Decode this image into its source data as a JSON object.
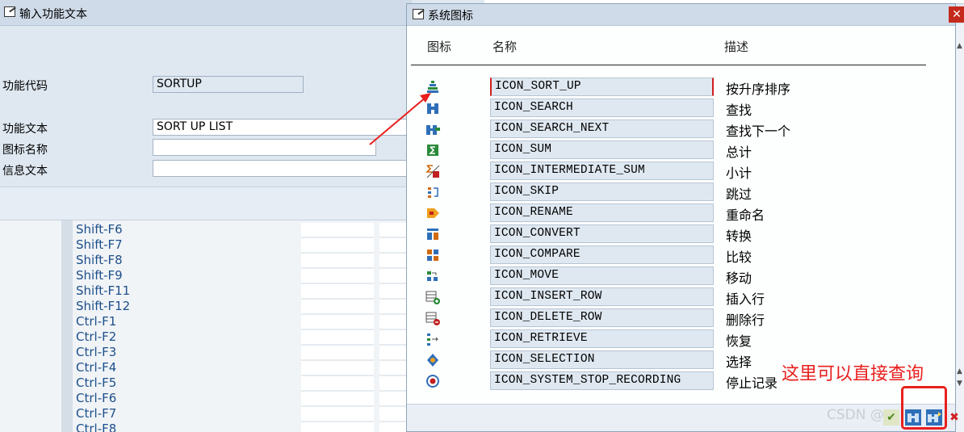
{
  "background_dialog": {
    "title": "输入功能文本",
    "fields": {
      "function_code_label": "功能代码",
      "function_code_value": "SORTUP",
      "function_text_label": "功能文本",
      "function_text_value": "SORT UP LIST",
      "icon_name_label": "图标名称",
      "icon_name_value": "",
      "info_text_label": "信息文本",
      "info_text_value": ""
    },
    "key_list": [
      "Shift-F6",
      "Shift-F7",
      "Shift-F8",
      "Shift-F9",
      "Shift-F11",
      "Shift-F12",
      "Ctrl-F1",
      "Ctrl-F2",
      "Ctrl-F3",
      "Ctrl-F4",
      "Ctrl-F5",
      "Ctrl-F6",
      "Ctrl-F7",
      "Ctrl-F8"
    ]
  },
  "popup": {
    "title": "系统图标",
    "headers": {
      "icon": "图标",
      "name": "名称",
      "description": "描述"
    },
    "rows": [
      {
        "icon": "sort-up-icon",
        "name": "ICON_SORT_UP",
        "description": "按升序排序",
        "selected": true
      },
      {
        "icon": "search-icon",
        "name": "ICON_SEARCH",
        "description": "查找"
      },
      {
        "icon": "search-next-icon",
        "name": "ICON_SEARCH_NEXT",
        "description": "查找下一个"
      },
      {
        "icon": "sum-icon",
        "name": "ICON_SUM",
        "description": "总计"
      },
      {
        "icon": "intermediate-sum-icon",
        "name": "ICON_INTERMEDIATE_SUM",
        "description": "小计"
      },
      {
        "icon": "skip-icon",
        "name": "ICON_SKIP",
        "description": "跳过"
      },
      {
        "icon": "rename-icon",
        "name": "ICON_RENAME",
        "description": "重命名"
      },
      {
        "icon": "convert-icon",
        "name": "ICON_CONVERT",
        "description": "转换"
      },
      {
        "icon": "compare-icon",
        "name": "ICON_COMPARE",
        "description": "比较"
      },
      {
        "icon": "move-icon",
        "name": "ICON_MOVE",
        "description": "移动"
      },
      {
        "icon": "insert-row-icon",
        "name": "ICON_INSERT_ROW",
        "description": "插入行"
      },
      {
        "icon": "delete-row-icon",
        "name": "ICON_DELETE_ROW",
        "description": "删除行"
      },
      {
        "icon": "retrieve-icon",
        "name": "ICON_RETRIEVE",
        "description": "恢复"
      },
      {
        "icon": "selection-icon",
        "name": "ICON_SELECTION",
        "description": "选择"
      },
      {
        "icon": "stop-recording-icon",
        "name": "ICON_SYSTEM_STOP_RECORDING",
        "description": "停止记录"
      }
    ],
    "footer_buttons": [
      "confirm-icon",
      "find-icon",
      "find-next-icon",
      "cancel-icon"
    ]
  },
  "annotation": {
    "text": "这里可以直接查询",
    "color": "#e8201e"
  },
  "watermark": "CSDN @",
  "colors": {
    "name_field_bg": "#dfe8f1",
    "key_text": "#1d4f8a",
    "close_button": "#c42b1c"
  }
}
